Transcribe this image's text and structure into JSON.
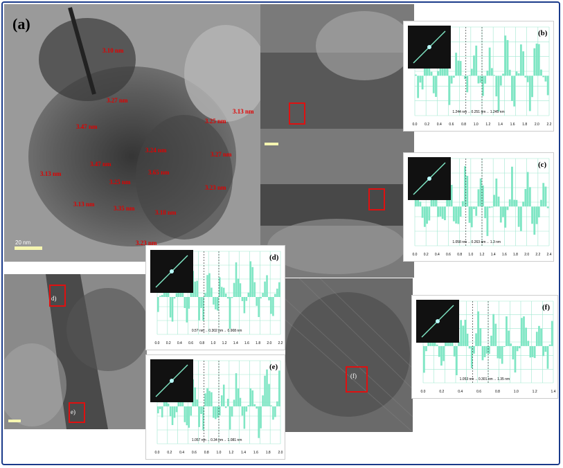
{
  "panel_a": {
    "letter": "(a)",
    "scale_bar": "20 nm",
    "spacings": [
      "3.10 nm",
      "3.27 nm",
      "3.13 nm",
      "3.47 nm",
      "3.25 nm",
      "3.24 nm",
      "3.47 nm",
      "3.25 nm",
      "3.27 nm",
      "3.65 nm",
      "3.13 nm",
      "3.23 nm",
      "3.13 nm",
      "3.35 nm",
      "3.18 nm",
      "3.23 nm"
    ]
  },
  "panel_b": {
    "letter": "(b)",
    "readout": "1.244 nm  ←0.251 nm→  1.245 nm",
    "xticks": [
      "0.0",
      "0.2",
      "0.4",
      "0.6",
      "0.8",
      "1.0",
      "1.2",
      "1.4",
      "1.6",
      "1.8",
      "2.0",
      "2.2"
    ]
  },
  "panel_c": {
    "letter": "(c)",
    "readout": "1.058 nm  ←0.263 nm→  1.3 nm",
    "xticks": [
      "0.0",
      "0.2",
      "0.4",
      "0.6",
      "0.8",
      "1.0",
      "1.2",
      "1.4",
      "1.6",
      "1.8",
      "2.0",
      "2.2",
      "2.4"
    ]
  },
  "panel_d": {
    "letter": "(d)",
    "readout": "0.5? nm ←0.302 nm→ 0.908 nm",
    "xticks": [
      "0.0",
      "0.2",
      "0.4",
      "0.6",
      "0.8",
      "1.0",
      "1.2",
      "1.4",
      "1.6",
      "1.8",
      "2.0",
      "2.2"
    ]
  },
  "panel_e": {
    "letter": "(e)",
    "readout": "1.057 nm ←0.34 nm→ 1.081 nm",
    "xticks": [
      "0.0",
      "0.2",
      "0.4",
      "0.6",
      "0.8",
      "1.0",
      "1.2",
      "1.4",
      "1.6",
      "1.8",
      "2.0"
    ]
  },
  "panel_f": {
    "letter": "(f)",
    "readout": "1.053 nm ←0.301 nm→ 1.35 nm",
    "xticks": [
      "0.0",
      "0.2",
      "0.4",
      "0.6",
      "0.8",
      "1.0",
      "1.2",
      "1.4"
    ]
  },
  "region_labels": {
    "d": "d)",
    "e": "e)",
    "f": "(f)"
  },
  "colors": {
    "bar": "#7fe6c4",
    "grid": "#9fe8d0",
    "box": "#e01010",
    "label": "#e00000"
  }
}
